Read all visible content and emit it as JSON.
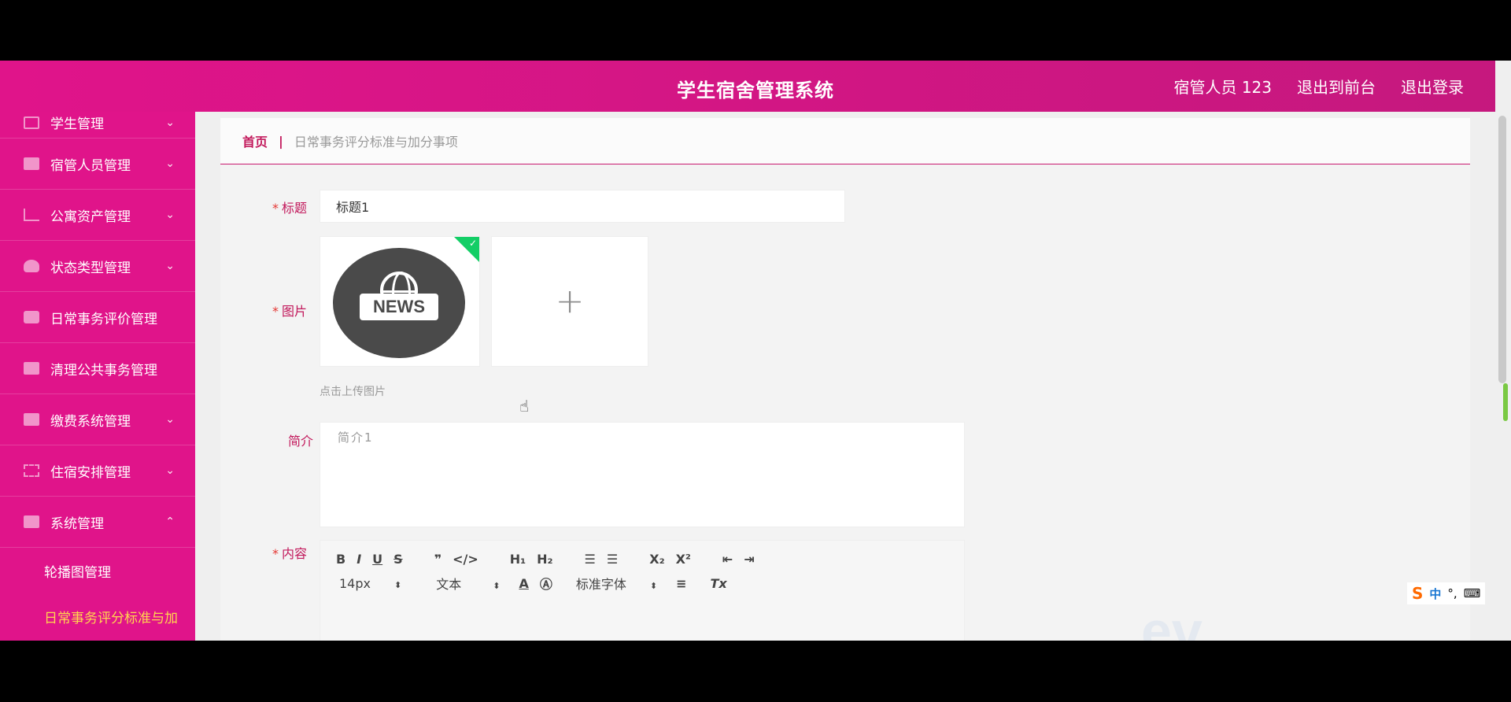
{
  "header": {
    "title": "学生宿舍管理系统",
    "user": "宿管人员 123",
    "to_frontend": "退出到前台",
    "logout": "退出登录"
  },
  "sidebar": {
    "items": [
      {
        "label": "学生管理",
        "icon": "student-icon",
        "has_children": true
      },
      {
        "label": "宿管人员管理",
        "icon": "monitor-icon",
        "has_children": true
      },
      {
        "label": "公寓资产管理",
        "icon": "chart-icon",
        "has_children": true
      },
      {
        "label": "状态类型管理",
        "icon": "heart-icon",
        "has_children": true
      },
      {
        "label": "日常事务评价管理",
        "icon": "document-icon",
        "has_children": false
      },
      {
        "label": "清理公共事务管理",
        "icon": "list-icon",
        "has_children": false
      },
      {
        "label": "缴费系统管理",
        "icon": "calendar-icon",
        "has_children": true
      },
      {
        "label": "住宿安排管理",
        "icon": "grid-icon",
        "has_children": true
      },
      {
        "label": "系统管理",
        "icon": "settings-icon",
        "has_children": true,
        "expanded": true
      }
    ],
    "sub_items": [
      {
        "label": "轮播图管理",
        "active": false
      },
      {
        "label": "日常事务评分标准与加",
        "active": true
      }
    ],
    "chevron_down": "⌄",
    "chevron_up": "⌃"
  },
  "breadcrumb": {
    "home": "首页",
    "separator": "|",
    "current": "日常事务评分标准与加分事项"
  },
  "form": {
    "title_label": "标题",
    "title_value": "标题1",
    "image_label": "图片",
    "image_badge": "NEWS",
    "upload_plus": "+",
    "upload_hint": "点击上传图片",
    "intro_label": "简介",
    "intro_value": "简介1",
    "content_label": "内容",
    "required_mark": "*"
  },
  "editor": {
    "row1": [
      "B",
      "I",
      "U",
      "S",
      "❞",
      "</>",
      "H₁",
      "H₂",
      "☰",
      "☰",
      "X₂",
      "X²",
      "⇤",
      "⇥"
    ],
    "font_size": "14px",
    "header_type": "文本",
    "font_family": "标准字体",
    "clear_format": "Tx"
  },
  "ime": {
    "logo": "S",
    "mode": "中",
    "punct": "°,"
  },
  "watermark": "ev"
}
